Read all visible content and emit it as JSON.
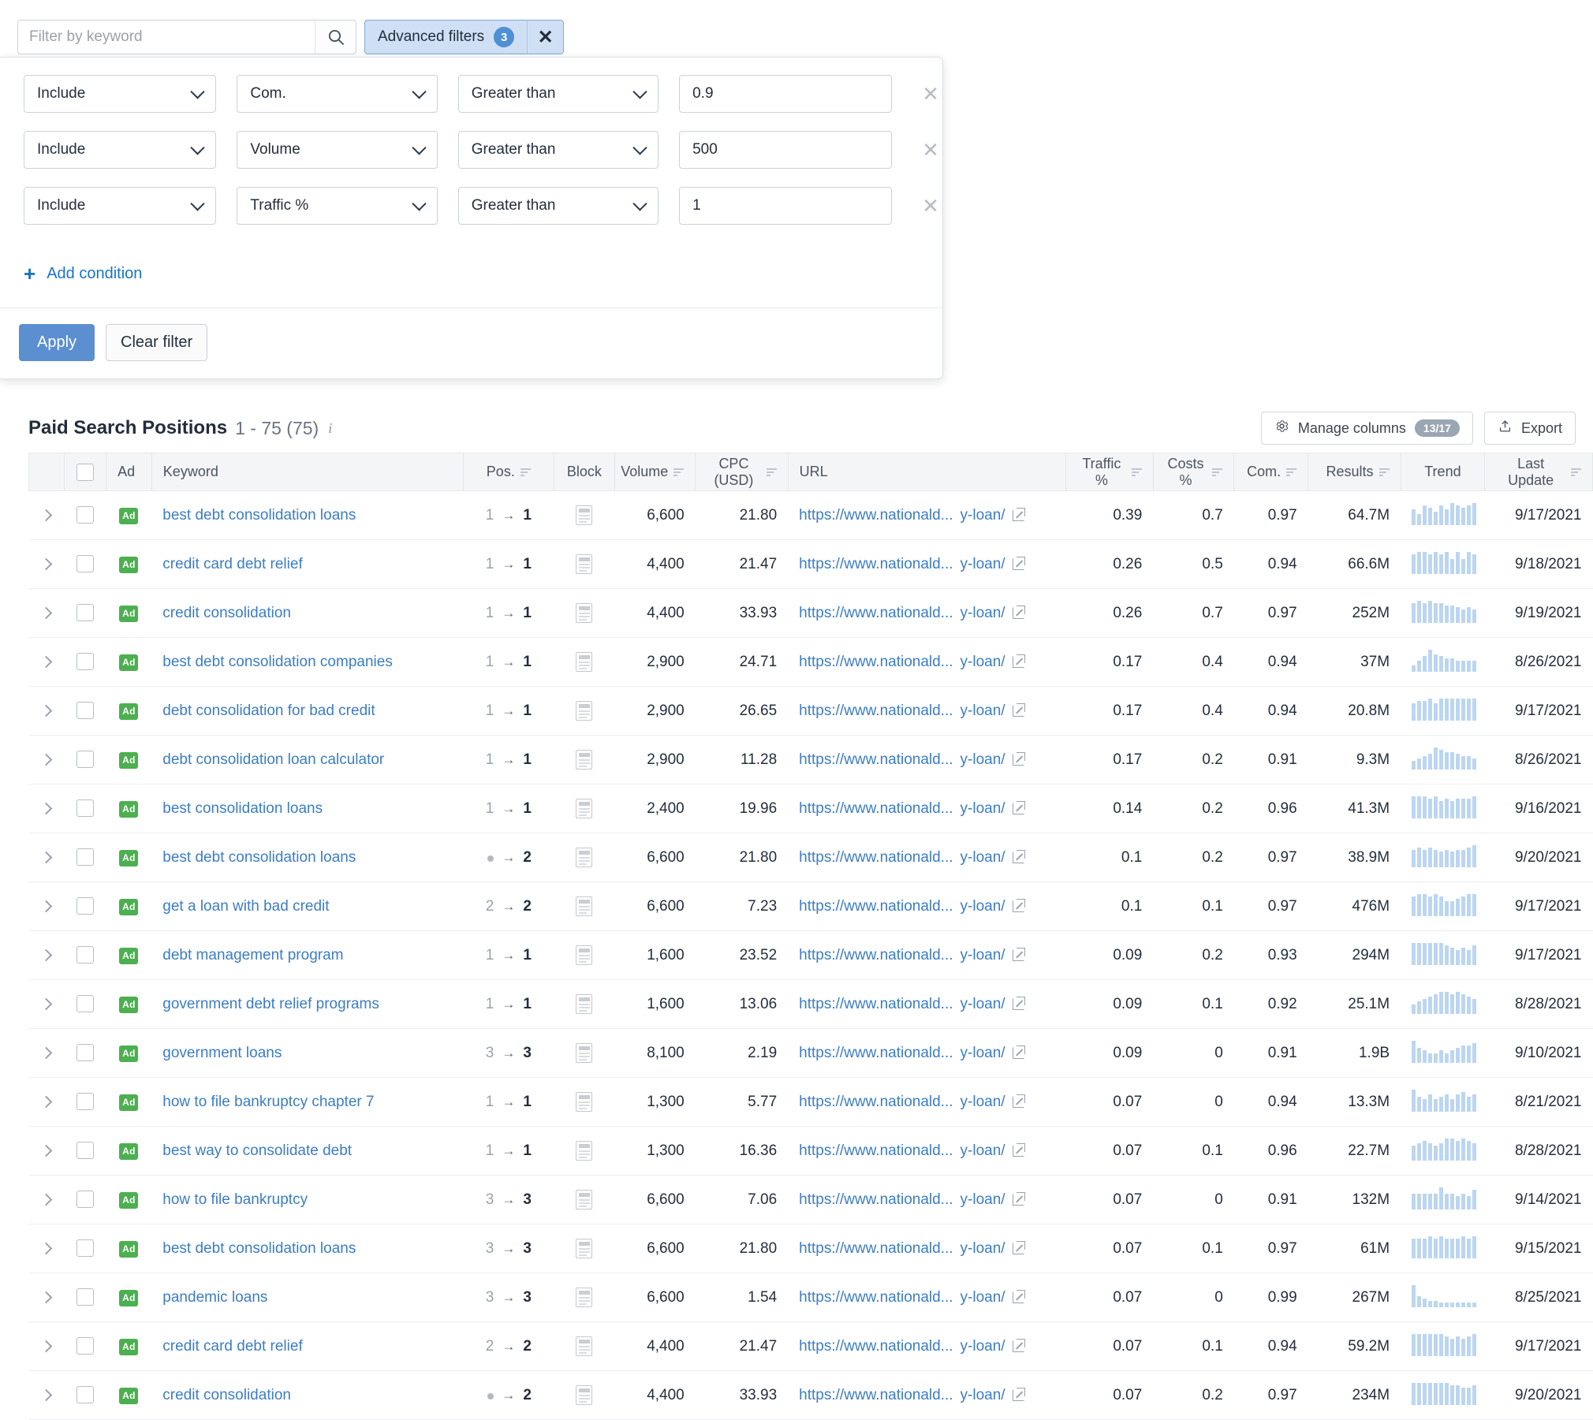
{
  "search": {
    "placeholder": "Filter by keyword",
    "value": "",
    "icon": "search-icon"
  },
  "advanced_filters": {
    "label": "Advanced filters",
    "count": "3",
    "close_label": "✕"
  },
  "filter_panel": {
    "conditions": [
      {
        "operator": "Include",
        "field": "Com.",
        "comparator": "Greater than",
        "value": "0.9",
        "remove": "✕"
      },
      {
        "operator": "Include",
        "field": "Volume",
        "comparator": "Greater than",
        "value": "500",
        "remove": "✕"
      },
      {
        "operator": "Include",
        "field": "Traffic %",
        "comparator": "Greater than",
        "value": "1",
        "remove": "✕"
      }
    ],
    "add_condition": "Add condition",
    "add_plus": "+",
    "apply": "Apply",
    "clear": "Clear filter"
  },
  "section": {
    "title": "Paid Search Positions",
    "range": "1 - 75 (75)",
    "info": "i",
    "manage_columns": "Manage columns",
    "manage_columns_count": "13/17",
    "export": "Export"
  },
  "table": {
    "columns": [
      {
        "label": "",
        "sortable": false
      },
      {
        "label": "",
        "sortable": false
      },
      {
        "label": "Ad",
        "sortable": false
      },
      {
        "label": "Keyword",
        "sortable": false
      },
      {
        "label": "Pos.",
        "sortable": true
      },
      {
        "label": "Block",
        "sortable": false
      },
      {
        "label": "Volume",
        "sortable": true
      },
      {
        "label": "CPC (USD)",
        "sortable": true
      },
      {
        "label": "URL",
        "sortable": false
      },
      {
        "label": "Traffic %",
        "sortable": true
      },
      {
        "label": "Costs %",
        "sortable": true
      },
      {
        "label": "Com.",
        "sortable": true
      },
      {
        "label": "Results",
        "sortable": true
      },
      {
        "label": "Trend",
        "sortable": false
      },
      {
        "label": "Last Update",
        "sortable": true
      }
    ],
    "url_prefix": "https://www.nationald...",
    "url_suffix": "y-loan/",
    "ad_badge": "Ad",
    "rows": [
      {
        "keyword": "best debt consolidation loans",
        "pos_prev": "1",
        "pos_now": "1",
        "volume": "6,600",
        "cpc": "21.80",
        "traffic": "0.39",
        "costs": "0.7",
        "com": "0.97",
        "results": "64.7M",
        "updated": "9/17/2021",
        "trend": [
          7,
          5,
          9,
          8,
          6,
          9,
          7,
          10,
          9,
          8,
          9,
          10
        ]
      },
      {
        "keyword": "credit card debt relief",
        "pos_prev": "1",
        "pos_now": "1",
        "volume": "4,400",
        "cpc": "21.47",
        "traffic": "0.26",
        "costs": "0.5",
        "com": "0.94",
        "results": "66.6M",
        "updated": "9/18/2021",
        "trend": [
          8,
          9,
          9,
          8,
          9,
          8,
          9,
          6,
          9,
          6,
          9,
          8
        ]
      },
      {
        "keyword": "credit consolidation",
        "pos_prev": "1",
        "pos_now": "1",
        "volume": "4,400",
        "cpc": "33.93",
        "traffic": "0.26",
        "costs": "0.7",
        "com": "0.97",
        "results": "252M",
        "updated": "9/19/2021",
        "trend": [
          9,
          10,
          9,
          10,
          9,
          9,
          8,
          8,
          7,
          6,
          7,
          6
        ]
      },
      {
        "keyword": "best debt consolidation companies",
        "pos_prev": "1",
        "pos_now": "1",
        "volume": "2,900",
        "cpc": "24.71",
        "traffic": "0.17",
        "costs": "0.4",
        "com": "0.94",
        "results": "37M",
        "updated": "8/26/2021",
        "trend": [
          3,
          5,
          7,
          10,
          8,
          7,
          6,
          6,
          5,
          5,
          5,
          5
        ]
      },
      {
        "keyword": "debt consolidation for bad credit",
        "pos_prev": "1",
        "pos_now": "1",
        "volume": "2,900",
        "cpc": "26.65",
        "traffic": "0.17",
        "costs": "0.4",
        "com": "0.94",
        "results": "20.8M",
        "updated": "9/17/2021",
        "trend": [
          7,
          8,
          8,
          9,
          7,
          9,
          9,
          9,
          9,
          9,
          9,
          9
        ]
      },
      {
        "keyword": "debt consolidation loan calculator",
        "pos_prev": "1",
        "pos_now": "1",
        "volume": "2,900",
        "cpc": "11.28",
        "traffic": "0.17",
        "costs": "0.2",
        "com": "0.91",
        "results": "9.3M",
        "updated": "8/26/2021",
        "trend": [
          4,
          5,
          6,
          7,
          10,
          9,
          8,
          8,
          7,
          6,
          6,
          5
        ]
      },
      {
        "keyword": "best consolidation loans",
        "pos_prev": "1",
        "pos_now": "1",
        "volume": "2,400",
        "cpc": "19.96",
        "traffic": "0.14",
        "costs": "0.2",
        "com": "0.96",
        "results": "41.3M",
        "updated": "9/16/2021",
        "trend": [
          9,
          9,
          9,
          8,
          9,
          7,
          8,
          7,
          8,
          8,
          8,
          9
        ]
      },
      {
        "keyword": "best debt consolidation loans",
        "pos_prev": "",
        "pos_now": "2",
        "volume": "6,600",
        "cpc": "21.80",
        "traffic": "0.1",
        "costs": "0.2",
        "com": "0.97",
        "results": "38.9M",
        "updated": "9/20/2021",
        "trend": [
          8,
          9,
          8,
          9,
          8,
          7,
          8,
          7,
          8,
          8,
          9,
          10
        ]
      },
      {
        "keyword": "get a loan with bad credit",
        "pos_prev": "2",
        "pos_now": "2",
        "volume": "6,600",
        "cpc": "7.23",
        "traffic": "0.1",
        "costs": "0.1",
        "com": "0.97",
        "results": "476M",
        "updated": "9/17/2021",
        "trend": [
          8,
          9,
          9,
          8,
          9,
          8,
          6,
          6,
          7,
          8,
          9,
          9
        ]
      },
      {
        "keyword": "debt management program",
        "pos_prev": "1",
        "pos_now": "1",
        "volume": "1,600",
        "cpc": "23.52",
        "traffic": "0.09",
        "costs": "0.2",
        "com": "0.93",
        "results": "294M",
        "updated": "9/17/2021",
        "trend": [
          9,
          9,
          9,
          9,
          9,
          9,
          8,
          7,
          6,
          7,
          6,
          8
        ]
      },
      {
        "keyword": "government debt relief programs",
        "pos_prev": "1",
        "pos_now": "1",
        "volume": "1,600",
        "cpc": "13.06",
        "traffic": "0.09",
        "costs": "0.1",
        "com": "0.92",
        "results": "25.1M",
        "updated": "8/28/2021",
        "trend": [
          4,
          5,
          6,
          7,
          8,
          9,
          9,
          8,
          9,
          8,
          7,
          6
        ]
      },
      {
        "keyword": "government loans",
        "pos_prev": "3",
        "pos_now": "3",
        "volume": "8,100",
        "cpc": "2.19",
        "traffic": "0.09",
        "costs": "0",
        "com": "0.91",
        "results": "1.9B",
        "updated": "9/10/2021",
        "trend": [
          9,
          6,
          5,
          4,
          4,
          5,
          4,
          5,
          6,
          7,
          7,
          8
        ]
      },
      {
        "keyword": "how to file bankruptcy chapter 7",
        "pos_prev": "1",
        "pos_now": "1",
        "volume": "1,300",
        "cpc": "5.77",
        "traffic": "0.07",
        "costs": "0",
        "com": "0.94",
        "results": "13.3M",
        "updated": "8/21/2021",
        "trend": [
          9,
          6,
          5,
          7,
          5,
          6,
          7,
          5,
          7,
          8,
          6,
          7
        ]
      },
      {
        "keyword": "best way to consolidate debt",
        "pos_prev": "1",
        "pos_now": "1",
        "volume": "1,300",
        "cpc": "16.36",
        "traffic": "0.07",
        "costs": "0.1",
        "com": "0.96",
        "results": "22.7M",
        "updated": "8/28/2021",
        "trend": [
          6,
          7,
          8,
          7,
          6,
          7,
          9,
          9,
          8,
          9,
          8,
          7
        ]
      },
      {
        "keyword": "how to file bankruptcy",
        "pos_prev": "3",
        "pos_now": "3",
        "volume": "6,600",
        "cpc": "7.06",
        "traffic": "0.07",
        "costs": "0",
        "com": "0.91",
        "results": "132M",
        "updated": "9/14/2021",
        "trend": [
          7,
          7,
          7,
          7,
          7,
          10,
          7,
          7,
          6,
          7,
          6,
          9
        ]
      },
      {
        "keyword": "best debt consolidation loans",
        "pos_prev": "3",
        "pos_now": "3",
        "volume": "6,600",
        "cpc": "21.80",
        "traffic": "0.07",
        "costs": "0.1",
        "com": "0.97",
        "results": "61M",
        "updated": "9/15/2021",
        "trend": [
          8,
          8,
          8,
          9,
          8,
          9,
          8,
          8,
          8,
          9,
          8,
          9
        ]
      },
      {
        "keyword": "pandemic loans",
        "pos_prev": "3",
        "pos_now": "3",
        "volume": "6,600",
        "cpc": "1.54",
        "traffic": "0.07",
        "costs": "0",
        "com": "0.99",
        "results": "267M",
        "updated": "8/25/2021",
        "trend": [
          10,
          5,
          4,
          3,
          3,
          2,
          2,
          2,
          2,
          2,
          2,
          2
        ]
      },
      {
        "keyword": "credit card debt relief",
        "pos_prev": "2",
        "pos_now": "2",
        "volume": "4,400",
        "cpc": "21.47",
        "traffic": "0.07",
        "costs": "0.1",
        "com": "0.94",
        "results": "59.2M",
        "updated": "9/17/2021",
        "trend": [
          9,
          9,
          9,
          9,
          9,
          9,
          8,
          7,
          8,
          7,
          8,
          9
        ]
      },
      {
        "keyword": "credit consolidation",
        "pos_prev": "",
        "pos_now": "2",
        "volume": "4,400",
        "cpc": "33.93",
        "traffic": "0.07",
        "costs": "0.2",
        "com": "0.97",
        "results": "234M",
        "updated": "9/20/2021",
        "trend": [
          9,
          9,
          9,
          9,
          9,
          9,
          9,
          8,
          8,
          7,
          7,
          8
        ]
      }
    ]
  }
}
